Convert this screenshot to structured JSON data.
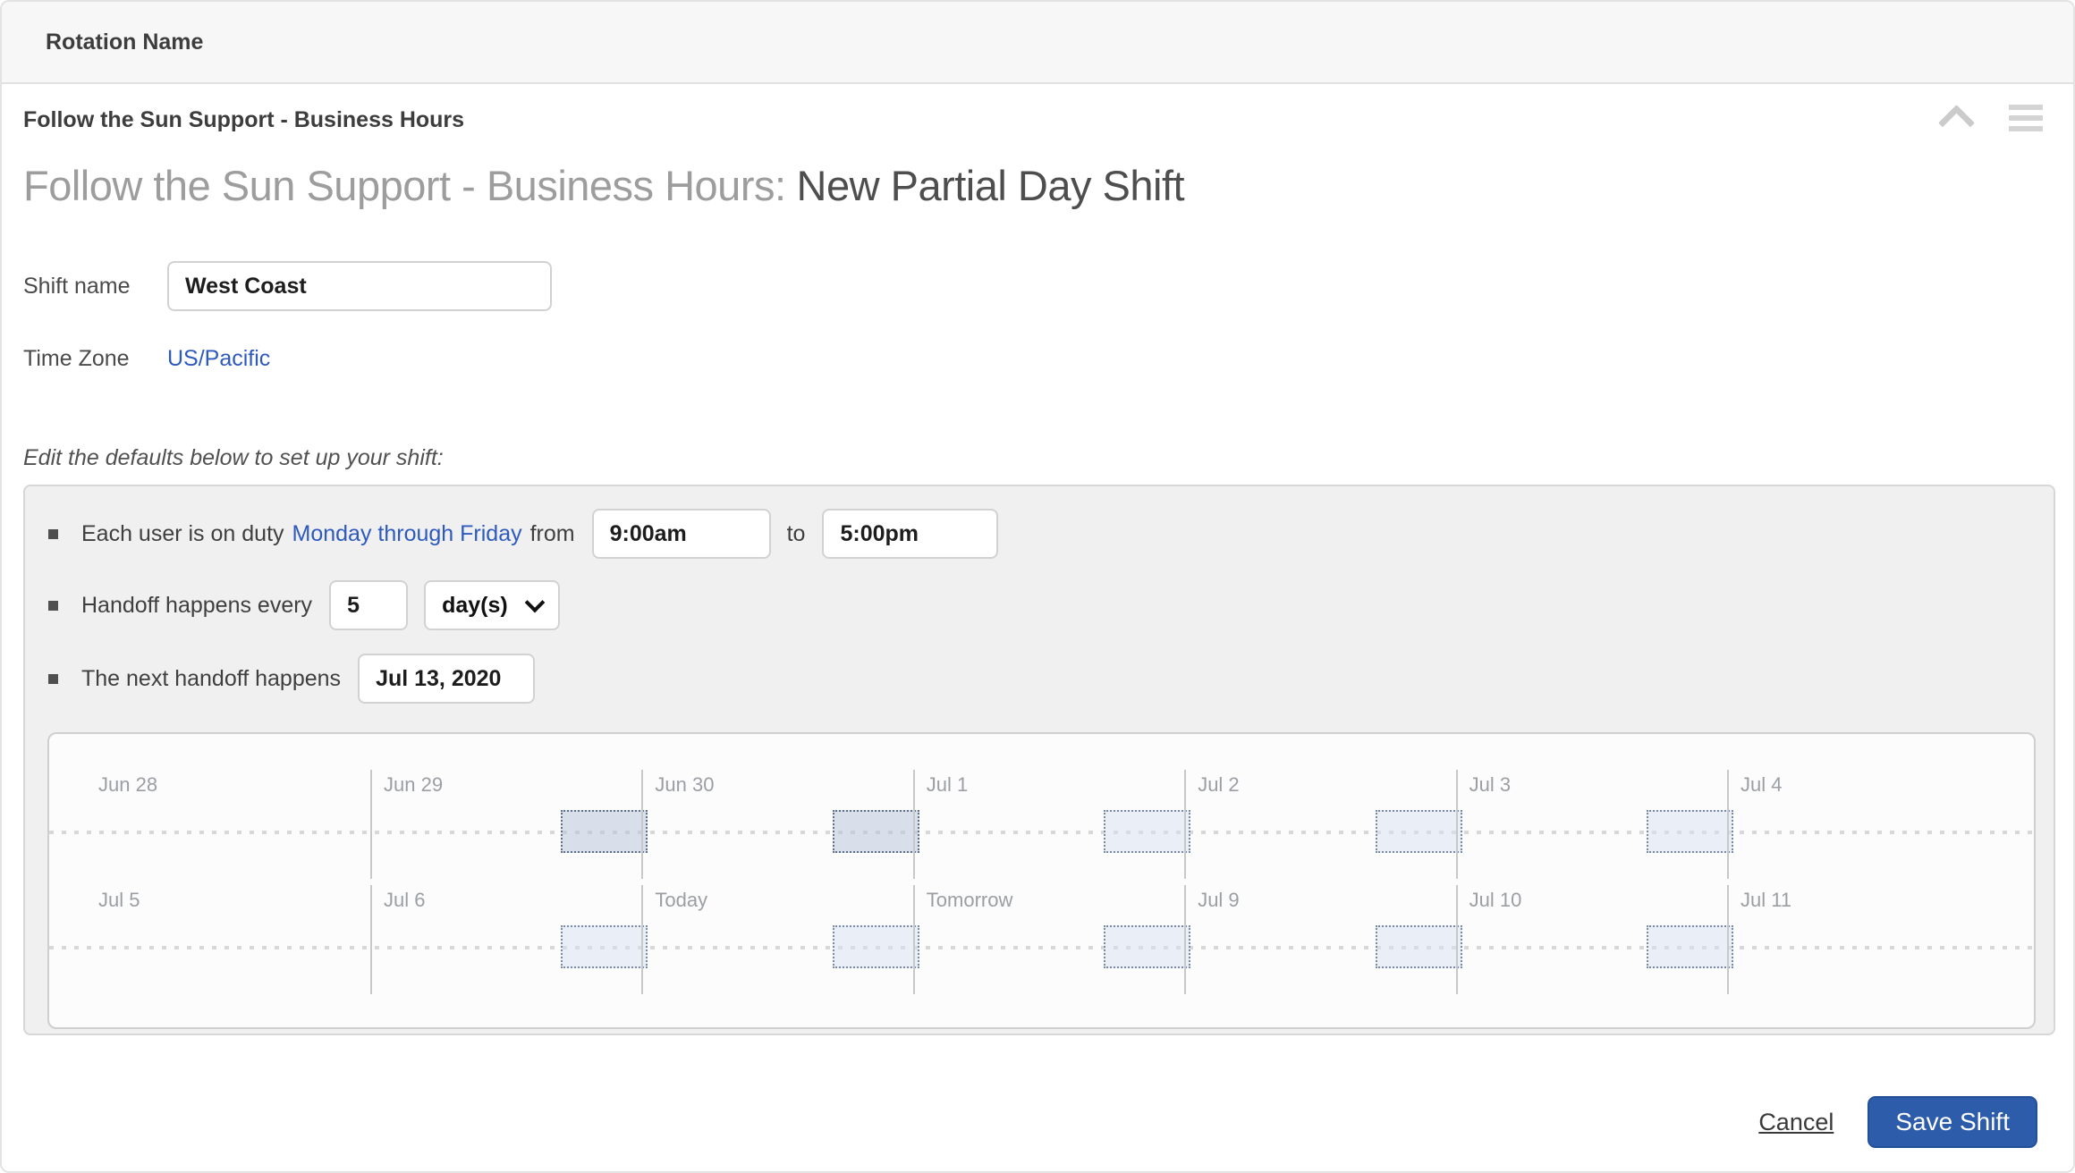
{
  "window": {
    "header_title": "Rotation Name"
  },
  "rotation": {
    "name": "Follow the Sun Support - Business Hours",
    "heading_prefix": "Follow the Sun Support - Business Hours:",
    "heading_highlight": "New Partial Day Shift"
  },
  "form": {
    "shift_name": {
      "label": "Shift name",
      "value": "West Coast"
    },
    "time_zone": {
      "label": "Time Zone",
      "value": "US/Pacific"
    },
    "instructions": "Edit the defaults below to set up your shift:"
  },
  "defaults": {
    "duty": {
      "text_pre": "Each user is on duty",
      "days_link": "Monday through Friday",
      "text_from": "from",
      "from_value": "9:00am",
      "text_to": "to",
      "to_value": "5:00pm"
    },
    "handoff": {
      "text_pre": "Handoff happens every",
      "interval_value": "5",
      "unit_value": "day(s)"
    },
    "next_handoff": {
      "text_pre": "The next handoff happens",
      "date_value": "Jul 13, 2020"
    }
  },
  "timeline": {
    "rows": [
      {
        "days": [
          "Jun 28",
          "Jun 29",
          "Jun 30",
          "Jul 1",
          "Jul 2",
          "Jul 3",
          "Jul 4"
        ],
        "blocks": [
          {
            "day": 2,
            "variant": "active"
          },
          {
            "day": 3,
            "variant": "active"
          },
          {
            "day": 4,
            "variant": "preview"
          },
          {
            "day": 5,
            "variant": "preview"
          },
          {
            "day": 6,
            "variant": "preview"
          }
        ]
      },
      {
        "days": [
          "Jul 5",
          "Jul 6",
          "Today",
          "Tomorrow",
          "Jul 9",
          "Jul 10",
          "Jul 11"
        ],
        "blocks": [
          {
            "day": 2,
            "variant": "preview"
          },
          {
            "day": 3,
            "variant": "preview"
          },
          {
            "day": 4,
            "variant": "preview"
          },
          {
            "day": 5,
            "variant": "preview"
          },
          {
            "day": 6,
            "variant": "preview"
          }
        ]
      }
    ]
  },
  "footer": {
    "cancel_label": "Cancel",
    "save_label": "Save Shift"
  },
  "icons": {
    "collapse": "chevron-up",
    "menu": "hamburger",
    "unit_dropdown": "chevron-down"
  },
  "colors": {
    "link_blue": "#2e5abe",
    "save_button_blue": "#2c5caa",
    "block_active_fill": "#dbe2ec",
    "block_preview_fill": "#edf1f7",
    "block_border_active": "#5f7187",
    "block_border_preview": "#7a8ba1"
  }
}
